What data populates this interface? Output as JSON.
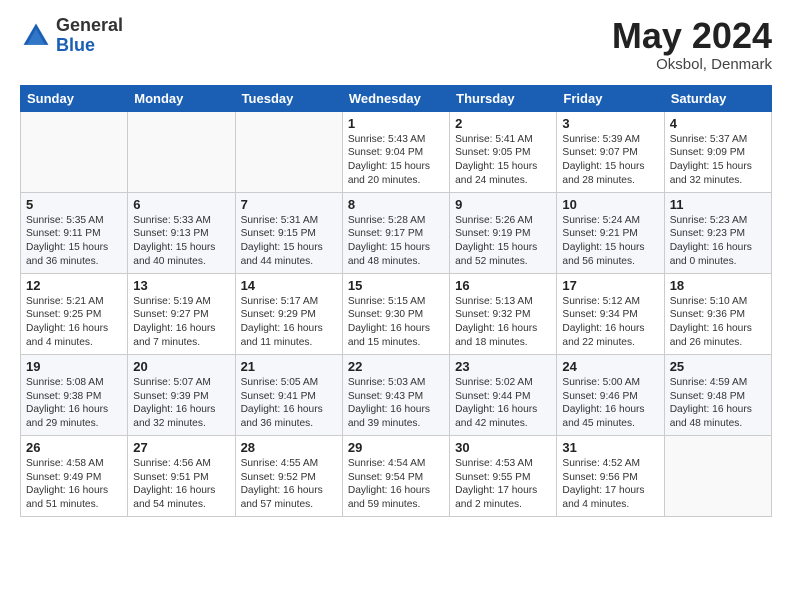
{
  "header": {
    "logo_general": "General",
    "logo_blue": "Blue",
    "month_year": "May 2024",
    "location": "Oksbol, Denmark"
  },
  "weekdays": [
    "Sunday",
    "Monday",
    "Tuesday",
    "Wednesday",
    "Thursday",
    "Friday",
    "Saturday"
  ],
  "weeks": [
    [
      {
        "day": "",
        "info": ""
      },
      {
        "day": "",
        "info": ""
      },
      {
        "day": "",
        "info": ""
      },
      {
        "day": "1",
        "info": "Sunrise: 5:43 AM\nSunset: 9:04 PM\nDaylight: 15 hours\nand 20 minutes."
      },
      {
        "day": "2",
        "info": "Sunrise: 5:41 AM\nSunset: 9:05 PM\nDaylight: 15 hours\nand 24 minutes."
      },
      {
        "day": "3",
        "info": "Sunrise: 5:39 AM\nSunset: 9:07 PM\nDaylight: 15 hours\nand 28 minutes."
      },
      {
        "day": "4",
        "info": "Sunrise: 5:37 AM\nSunset: 9:09 PM\nDaylight: 15 hours\nand 32 minutes."
      }
    ],
    [
      {
        "day": "5",
        "info": "Sunrise: 5:35 AM\nSunset: 9:11 PM\nDaylight: 15 hours\nand 36 minutes."
      },
      {
        "day": "6",
        "info": "Sunrise: 5:33 AM\nSunset: 9:13 PM\nDaylight: 15 hours\nand 40 minutes."
      },
      {
        "day": "7",
        "info": "Sunrise: 5:31 AM\nSunset: 9:15 PM\nDaylight: 15 hours\nand 44 minutes."
      },
      {
        "day": "8",
        "info": "Sunrise: 5:28 AM\nSunset: 9:17 PM\nDaylight: 15 hours\nand 48 minutes."
      },
      {
        "day": "9",
        "info": "Sunrise: 5:26 AM\nSunset: 9:19 PM\nDaylight: 15 hours\nand 52 minutes."
      },
      {
        "day": "10",
        "info": "Sunrise: 5:24 AM\nSunset: 9:21 PM\nDaylight: 15 hours\nand 56 minutes."
      },
      {
        "day": "11",
        "info": "Sunrise: 5:23 AM\nSunset: 9:23 PM\nDaylight: 16 hours\nand 0 minutes."
      }
    ],
    [
      {
        "day": "12",
        "info": "Sunrise: 5:21 AM\nSunset: 9:25 PM\nDaylight: 16 hours\nand 4 minutes."
      },
      {
        "day": "13",
        "info": "Sunrise: 5:19 AM\nSunset: 9:27 PM\nDaylight: 16 hours\nand 7 minutes."
      },
      {
        "day": "14",
        "info": "Sunrise: 5:17 AM\nSunset: 9:29 PM\nDaylight: 16 hours\nand 11 minutes."
      },
      {
        "day": "15",
        "info": "Sunrise: 5:15 AM\nSunset: 9:30 PM\nDaylight: 16 hours\nand 15 minutes."
      },
      {
        "day": "16",
        "info": "Sunrise: 5:13 AM\nSunset: 9:32 PM\nDaylight: 16 hours\nand 18 minutes."
      },
      {
        "day": "17",
        "info": "Sunrise: 5:12 AM\nSunset: 9:34 PM\nDaylight: 16 hours\nand 22 minutes."
      },
      {
        "day": "18",
        "info": "Sunrise: 5:10 AM\nSunset: 9:36 PM\nDaylight: 16 hours\nand 26 minutes."
      }
    ],
    [
      {
        "day": "19",
        "info": "Sunrise: 5:08 AM\nSunset: 9:38 PM\nDaylight: 16 hours\nand 29 minutes."
      },
      {
        "day": "20",
        "info": "Sunrise: 5:07 AM\nSunset: 9:39 PM\nDaylight: 16 hours\nand 32 minutes."
      },
      {
        "day": "21",
        "info": "Sunrise: 5:05 AM\nSunset: 9:41 PM\nDaylight: 16 hours\nand 36 minutes."
      },
      {
        "day": "22",
        "info": "Sunrise: 5:03 AM\nSunset: 9:43 PM\nDaylight: 16 hours\nand 39 minutes."
      },
      {
        "day": "23",
        "info": "Sunrise: 5:02 AM\nSunset: 9:44 PM\nDaylight: 16 hours\nand 42 minutes."
      },
      {
        "day": "24",
        "info": "Sunrise: 5:00 AM\nSunset: 9:46 PM\nDaylight: 16 hours\nand 45 minutes."
      },
      {
        "day": "25",
        "info": "Sunrise: 4:59 AM\nSunset: 9:48 PM\nDaylight: 16 hours\nand 48 minutes."
      }
    ],
    [
      {
        "day": "26",
        "info": "Sunrise: 4:58 AM\nSunset: 9:49 PM\nDaylight: 16 hours\nand 51 minutes."
      },
      {
        "day": "27",
        "info": "Sunrise: 4:56 AM\nSunset: 9:51 PM\nDaylight: 16 hours\nand 54 minutes."
      },
      {
        "day": "28",
        "info": "Sunrise: 4:55 AM\nSunset: 9:52 PM\nDaylight: 16 hours\nand 57 minutes."
      },
      {
        "day": "29",
        "info": "Sunrise: 4:54 AM\nSunset: 9:54 PM\nDaylight: 16 hours\nand 59 minutes."
      },
      {
        "day": "30",
        "info": "Sunrise: 4:53 AM\nSunset: 9:55 PM\nDaylight: 17 hours\nand 2 minutes."
      },
      {
        "day": "31",
        "info": "Sunrise: 4:52 AM\nSunset: 9:56 PM\nDaylight: 17 hours\nand 4 minutes."
      },
      {
        "day": "",
        "info": ""
      }
    ]
  ]
}
